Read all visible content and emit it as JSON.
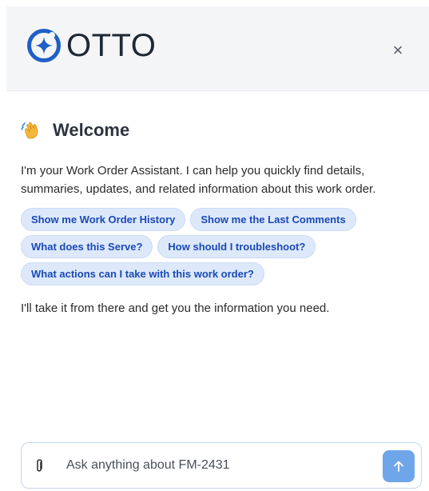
{
  "header": {
    "logo_text": "OTTO",
    "close_label": "×"
  },
  "welcome": {
    "title": "Welcome",
    "intro": "I'm your Work Order Assistant. I can help you quickly find details, summaries, updates, and related information about this work order.",
    "outro": "I'll take it from there and get you the information you need."
  },
  "suggestions": [
    "Show me Work Order History",
    "Show me the Last Comments",
    "What does this Serve?",
    "How should I troubleshoot?",
    "What actions can I take with this work order?"
  ],
  "composer": {
    "placeholder": "Ask anything about FM-2431"
  },
  "colors": {
    "accent": "#1a49b5",
    "chip_bg": "#dde9fb",
    "send_button": "#6fa6e9",
    "header_bg": "#f4f5f7",
    "logo_blue": "#1f5fc7"
  },
  "icons": {
    "logo": "otto-star-circle-icon",
    "close": "close-icon",
    "welcome": "waving-hand-icon",
    "attach": "paperclip-icon",
    "send": "arrow-up-icon"
  }
}
